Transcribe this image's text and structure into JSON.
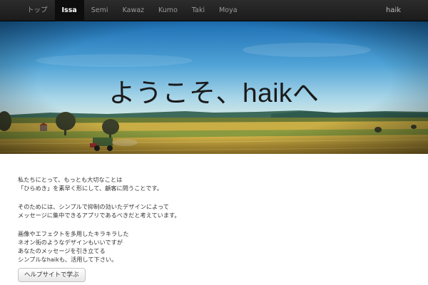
{
  "nav": {
    "items": [
      {
        "label": "トップ",
        "active": false
      },
      {
        "label": "Issa",
        "active": true
      },
      {
        "label": "Semi",
        "active": false
      },
      {
        "label": "Kawaz",
        "active": false
      },
      {
        "label": "Kumo",
        "active": false
      },
      {
        "label": "Taki",
        "active": false
      },
      {
        "label": "Moya",
        "active": false
      }
    ],
    "brand": "haik"
  },
  "hero": {
    "title": "ようこそ、haikへ"
  },
  "content": {
    "paragraphs": [
      [
        "私たちにとって、もっとも大切なことは",
        "「ひらめき」を素早く形にして、顧客に問うことです。"
      ],
      [
        "そのためには、シンプルで抑制の効いたデザインによって",
        "メッセージに集中できるアプリであるべきだと考えています。"
      ],
      [
        "画像やエフェクトを多用したキラキラした",
        "ネオン街のようなデザインもいいですが",
        "あなたのメッセージを引き立てる",
        "シンプルなhaikも、活用して下さい。"
      ]
    ]
  },
  "help_button": "ヘルプサイトで学ぶ"
}
